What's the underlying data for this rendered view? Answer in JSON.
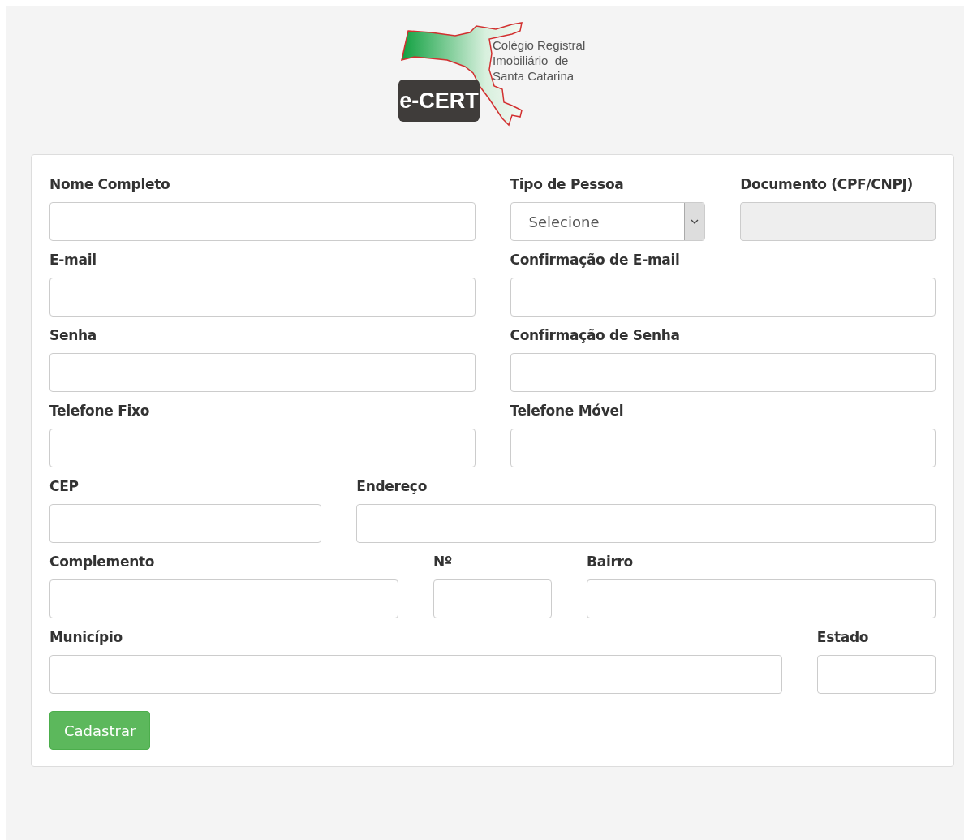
{
  "logo": {
    "badge": "e-CERT",
    "lines": [
      "Colégio Registral",
      "Imobiliário  de",
      "Santa Catarina"
    ]
  },
  "rows": [
    {
      "fields": [
        {
          "label": "Nome Completo",
          "kind": "text",
          "disabled": false
        },
        {
          "label": "Tipo de Pessoa",
          "kind": "select",
          "value": "Selecione",
          "disabled": false
        },
        {
          "label": "Documento (CPF/CNPJ)",
          "kind": "text",
          "disabled": true
        }
      ]
    },
    {
      "fields": [
        {
          "label": "E-mail",
          "kind": "text",
          "disabled": false
        },
        {
          "label": "Confirmação de E-mail",
          "kind": "text",
          "disabled": false
        }
      ]
    },
    {
      "fields": [
        {
          "label": "Senha",
          "kind": "password",
          "disabled": false
        },
        {
          "label": "Confirmação de Senha",
          "kind": "password",
          "disabled": false
        }
      ]
    },
    {
      "fields": [
        {
          "label": "Telefone Fixo",
          "kind": "text",
          "disabled": false
        },
        {
          "label": "Telefone Móvel",
          "kind": "text",
          "disabled": false
        }
      ]
    },
    {
      "fields": [
        {
          "label": "CEP",
          "kind": "text",
          "disabled": false
        },
        {
          "label": "Endereço",
          "kind": "text",
          "disabled": false
        }
      ]
    },
    {
      "fields": [
        {
          "label": "Complemento",
          "kind": "text",
          "disabled": false
        },
        {
          "label": "Nº",
          "kind": "text",
          "disabled": false
        },
        {
          "label": "Bairro",
          "kind": "text",
          "disabled": false
        }
      ]
    },
    {
      "fields": [
        {
          "label": "Município",
          "kind": "text",
          "disabled": false
        },
        {
          "label": "Estado",
          "kind": "text",
          "disabled": false
        }
      ]
    }
  ],
  "submit": "Cadastrar"
}
